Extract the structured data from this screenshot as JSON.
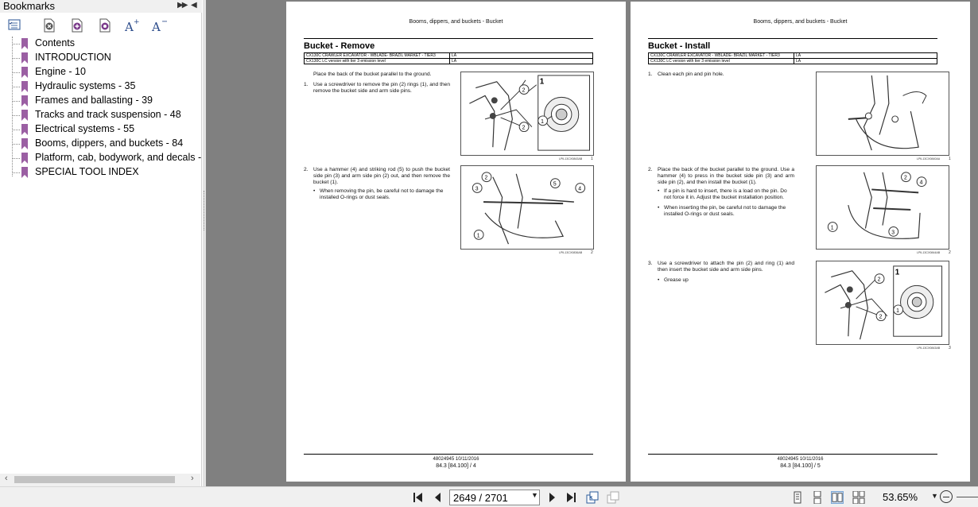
{
  "bookmarks": {
    "title": "Bookmarks",
    "items": [
      {
        "label": "Contents"
      },
      {
        "label": "INTRODUCTION"
      },
      {
        "label": "Engine - 10"
      },
      {
        "label": "Hydraulic systems - 35"
      },
      {
        "label": "Frames and ballasting - 39"
      },
      {
        "label": "Tracks and track suspension - 48"
      },
      {
        "label": "Electrical systems - 55"
      },
      {
        "label": "Booms, dippers, and buckets - 84"
      },
      {
        "label": "Platform, cab, bodywork, and decals -"
      },
      {
        "label": "SPECIAL TOOL INDEX"
      }
    ],
    "flag_color": "#9b5fa3"
  },
  "page_left": {
    "header": "Booms, dippers, and buckets - Bucket",
    "title": "Bucket - Remove",
    "table": [
      [
        "CX130C CRAWLER EXCAVATOR - WBLADE- BRAZIL MARKET - TIER3",
        "LA"
      ],
      [
        "CX130C LC version with tier 3 emission level",
        "LA"
      ]
    ],
    "intro": "Place the back of the bucket parallel to the ground.",
    "step1_num": "1.",
    "step1": "Use a screwdriver to remove the pin (2) rings (1), and then remove the bucket side and arm side pins.",
    "step2_num": "2.",
    "step2": "Use a hammer (4) and striking rod (5) to push the bucket side pin (3) and arm side pin (2) out, and then remove the bucket (1).",
    "step2_bullet": "When removing the pin, be careful not to damage the installed O-rings or dust seals.",
    "fig1_caption": "LPIL13CX0843AB",
    "fig1_num": "1",
    "fig2_caption": "LPIL13CX0836AB",
    "fig2_num": "2",
    "footer_1": "48024945 10/11/2016",
    "footer_2": "84.3 [84.100] / 4"
  },
  "page_right": {
    "header": "Booms, dippers, and buckets - Bucket",
    "title": "Bucket - Install",
    "table": [
      [
        "CX130C CRAWLER EXCAVATOR - WBLADE- BRAZIL MARKET - TIER3",
        "LA"
      ],
      [
        "CX130C LC version with tier 3 emission level",
        "LA"
      ]
    ],
    "step1_num": "1.",
    "step1": "Clean each pin and pin hole.",
    "step2_num": "2.",
    "step2": "Place the back of the bucket parallel to the ground. Use a hammer (4) to press in the bucket side pin (3) and arm side pin (2), and then install the bucket (1).",
    "step2_bullet1": "If a pin is hard to insert, there is a load on the pin. Do not force it in. Adjust the bucket installation position.",
    "step2_bullet2": "When inserting the pin, be careful not to damage the installed O-rings or dust seals.",
    "step3_num": "3.",
    "step3": "Use a screwdriver to attach the pin (2) and ring (1) and then insert the bucket side and arm side pins.",
    "step3_bullet": "Grease up",
    "fig1_caption": "LPIL13CX0840AA",
    "fig1_num": "1",
    "fig2_caption": "LPIL13CX0844AB",
    "fig2_num": "2",
    "fig3_caption": "LPIL13CX0843AB",
    "fig3_num": "3",
    "footer_1": "48024945 10/11/2016",
    "footer_2": "84.3 [84.100] / 5"
  },
  "statusbar": {
    "page_input": "2649 / 2701",
    "zoom": "53.65%"
  },
  "colors": {
    "doc_background": "#808080",
    "panel_background": "#f0f0f0"
  }
}
